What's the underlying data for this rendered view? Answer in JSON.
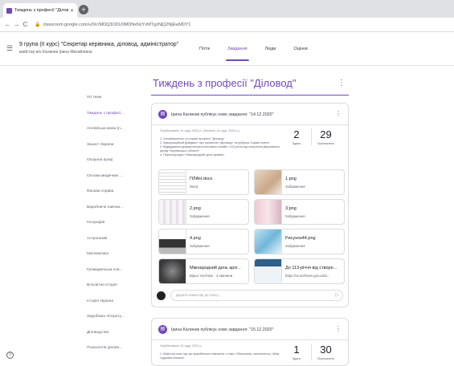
{
  "browser": {
    "tab_title": "Тиждень з професії \"Діловод\"",
    "tab_close": "✕",
    "new_tab": "+",
    "url": "classroom.google.com/u/0/c/MDQ3ODU0MDNxNzYzMTgzNjQ2NjEwMDY1"
  },
  "header": {
    "class_title": "9 група (ІІ курс) \"Секретар керівника, діловод, адміністратор\"",
    "class_subtitle": "майстер в/н Калиник Ірина Михайлівна",
    "tabs": [
      {
        "label": "Потік"
      },
      {
        "label": "Завдання",
        "active": true
      },
      {
        "label": "Люди"
      },
      {
        "label": "Оцінки"
      }
    ]
  },
  "sidebar": {
    "items": [
      {
        "label": "Усі теми"
      },
      {
        "label": "Тиждень з професі...",
        "active": true
      },
      {
        "label": "Англійська мова (п..."
      },
      {
        "label": "Захист України"
      },
      {
        "label": "Охорона праці"
      },
      {
        "label": "Основи медичних ..."
      },
      {
        "label": "Фахова справа"
      },
      {
        "label": "Виробниче навчан..."
      },
      {
        "label": "Географія"
      },
      {
        "label": "Астрономія"
      },
      {
        "label": "Математика"
      },
      {
        "label": "Громадянська осв..."
      },
      {
        "label": "Всесвітня історія"
      },
      {
        "label": "Історія України"
      },
      {
        "label": "Зарубіжна літерату..."
      },
      {
        "label": "Діловодство"
      },
      {
        "label": "Психологія ділово..."
      }
    ]
  },
  "topic": {
    "title": "Тиждень з професії \"Діловод\"",
    "more": "⋮"
  },
  "post1": {
    "title": "Ірина Калиник публікує нове завдання: \"14.12.2020\"",
    "posted": "Опубліковано 14 груд. 2020 р. (Змінено 14 груд. 2020 р.)",
    "description": [
      "1. Ознайомлення з історією професії \"Діловод\"",
      "2. Інформаційний Дайджест про професію «Діловод» та рубрика «Цікаві знати»",
      "3. Відвідування документальної виставки онлайн «113-річчя від створення Державного архіву Чернівецької області»",
      "4. Перегляд відео «Міжнародний день архівів»."
    ],
    "stats": [
      {
        "value": "2",
        "label": "Здано"
      },
      {
        "value": "29",
        "label": "Призначено"
      }
    ],
    "attachments": [
      {
        "name": "ПЛАН.docx",
        "type": "Word"
      },
      {
        "name": "1.png",
        "type": "Зображення"
      },
      {
        "name": "2.png",
        "type": "Зображення"
      },
      {
        "name": "3.png",
        "type": "Зображення"
      },
      {
        "name": "4.png",
        "type": "Зображення"
      },
      {
        "name": "Рисунок44.png",
        "type": "Зображення"
      },
      {
        "name": "Міжнародний день архі...",
        "type": "Відео YouTube · 3 хвилини"
      },
      {
        "name": "До 113-річчя від створе...",
        "type": "https://cv.archives.gov.ua/vi..."
      }
    ],
    "comment_placeholder": "Додати коментар до класу..."
  },
  "post2": {
    "title": "Ірина Калиник публікує нове завдання: \"15.12.2020\"",
    "posted": "Опубліковано 15 груд. 2020 р.",
    "description": [
      "1. Майстер-клас під час виробничого навчання з теми «Зберігання, запозичення, облік",
      "трудових книжок»."
    ],
    "stats": [
      {
        "value": "1",
        "label": "Здано"
      },
      {
        "value": "30",
        "label": "Призначено"
      }
    ]
  },
  "colors": {
    "accent": "#7248b9"
  }
}
